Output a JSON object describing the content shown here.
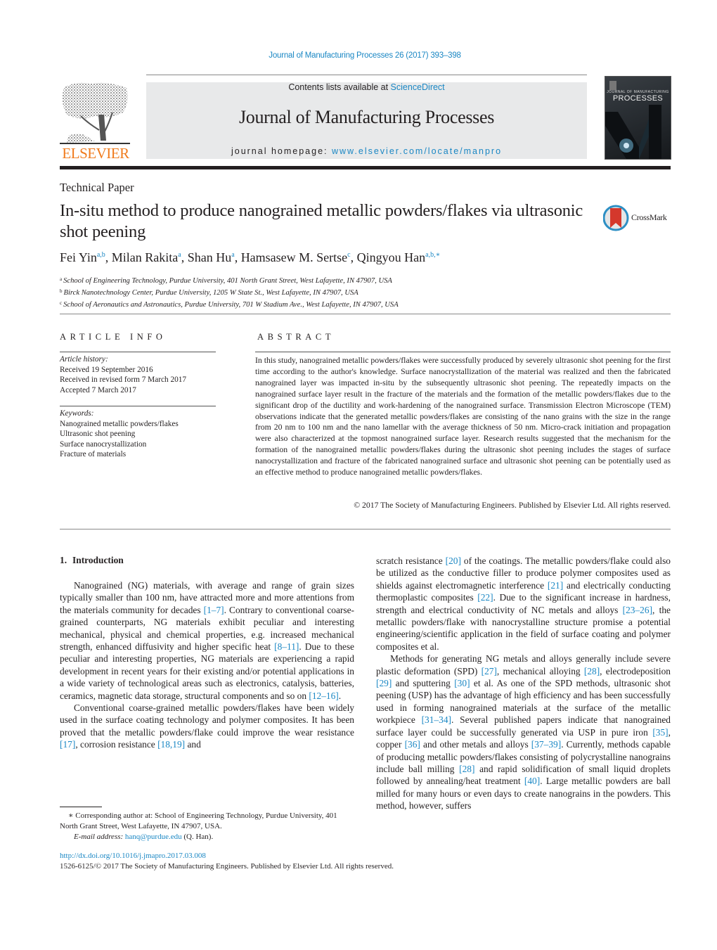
{
  "header": {
    "journal_ref": "Journal of Manufacturing Processes 26 (2017) 393–398",
    "contents_prefix": "Contents lists available at ",
    "contents_link": "ScienceDirect",
    "journal_title": "Journal of Manufacturing Processes",
    "homepage_prefix": "journal homepage: ",
    "homepage_link": "www.elsevier.com/locate/manpro",
    "publisher_logo_text": "ELSEVIER",
    "cover_title_small": "JOURNAL OF MANUFACTURING",
    "cover_title_large": "PROCESSES"
  },
  "article": {
    "section_type": "Technical Paper",
    "title": "In-situ method to produce nanograined metallic powders/flakes via ultrasonic shot peening",
    "crossmark_label": "CrossMark",
    "authors": [
      {
        "name": "Fei Yin",
        "sup": "a,b",
        "sep": ", "
      },
      {
        "name": "Milan Rakita",
        "sup": "a",
        "sep": ", "
      },
      {
        "name": "Shan Hu",
        "sup": "a",
        "sep": ", "
      },
      {
        "name": "Hamsasew M. Sertse",
        "sup": "c",
        "sep": ", "
      },
      {
        "name": "Qingyou Han",
        "sup": "a,b,∗",
        "sep": ""
      }
    ],
    "affiliations": [
      {
        "key": "a",
        "text": "School of Engineering Technology, Purdue University, 401 North Grant Street, West Lafayette, IN 47907, USA"
      },
      {
        "key": "b",
        "text": "Birck Nanotechnology Center, Purdue University, 1205 W State St., West Lafayette, IN 47907, USA"
      },
      {
        "key": "c",
        "text": "School of Aeronautics and Astronautics, Purdue University, 701 W Stadium Ave., West Lafayette, IN 47907, USA"
      }
    ]
  },
  "article_info": {
    "heading": "ARTICLE INFO",
    "history_label": "Article history:",
    "history": [
      "Received 19 September 2016",
      "Received in revised form 7 March 2017",
      "Accepted 7 March 2017"
    ],
    "keywords_label": "Keywords:",
    "keywords": [
      "Nanograined metallic powders/flakes",
      "Ultrasonic shot peening",
      "Surface nanocrystallization",
      "Fracture of materials"
    ]
  },
  "abstract": {
    "heading": "ABSTRACT",
    "text": "In this study, nanograined metallic powders/flakes were successfully produced by severely ultrasonic shot peening for the first time according to the author's knowledge. Surface nanocrystallization of the material was realized and then the fabricated nanograined layer was impacted in-situ by the subsequently ultrasonic shot peening. The repeatedly impacts on the nanograined surface layer result in the fracture of the materials and the formation of the metallic powders/flakes due to the significant drop of the ductility and work-hardening of the nanograined surface. Transmission Electron Microscope (TEM) observations indicate that the generated metallic powders/flakes are consisting of the nano grains with the size in the range from 20 nm to 100 nm and the nano lamellar with the average thickness of 50 nm. Micro-crack initiation and propagation were also characterized at the topmost nanograined surface layer. Research results suggested that the mechanism for the formation of the nanograined metallic powders/flakes during the ultrasonic shot peening includes the stages of surface nanocrystallization and fracture of the fabricated nanograined surface and ultrasonic shot peening can be potentially used as an effective method to produce nanograined metallic powders/flakes.",
    "copyright": "© 2017 The Society of Manufacturing Engineers. Published by Elsevier Ltd. All rights reserved."
  },
  "body": {
    "section_number": "1.",
    "section_title": "Introduction",
    "left_paragraphs": [
      [
        {
          "t": "Nanograined (NG) materials, with average and range of grain sizes typically smaller than 100 nm, have attracted more and more attentions from the materials community for decades "
        },
        {
          "ref": "[1–7]"
        },
        {
          "t": ". Contrary to conventional coarse-grained counterparts, NG materials exhibit peculiar and interesting mechanical, physical and chemical properties, e.g. increased mechanical strength, enhanced diffusivity and higher specific heat "
        },
        {
          "ref": "[8–11]"
        },
        {
          "t": ". Due to these peculiar and interesting properties, NG materials are experiencing a rapid development in recent years for their existing and/or potential applications in a wide variety of technological areas such as electronics, catalysis, batteries, ceramics, magnetic data storage, structural components and so on "
        },
        {
          "ref": "[12–16]"
        },
        {
          "t": "."
        }
      ],
      [
        {
          "t": "Conventional coarse-grained metallic powders/flakes have been widely used in the surface coating technology and polymer composites. It has been proved that the metallic powders/flake could improve the wear resistance "
        },
        {
          "ref": "[17]"
        },
        {
          "t": ", corrosion resistance "
        },
        {
          "ref": "[18,19]"
        },
        {
          "t": " and"
        }
      ]
    ],
    "right_paragraphs": [
      [
        {
          "t": "scratch resistance "
        },
        {
          "ref": "[20]"
        },
        {
          "t": " of the coatings. The metallic powders/flake could also be utilized as the conductive filler to produce polymer composites used as shields against electromagnetic interference "
        },
        {
          "ref": "[21]"
        },
        {
          "t": " and electrically conducting thermoplastic composites "
        },
        {
          "ref": "[22]"
        },
        {
          "t": ". Due to the significant increase in hardness, strength and electrical conductivity of NC metals and alloys "
        },
        {
          "ref": "[23–26]"
        },
        {
          "t": ", the metallic powders/flake with nanocrystalline structure promise a potential engineering/scientific application in the field of surface coating and polymer composites et al."
        }
      ],
      [
        {
          "t": "Methods for generating NG metals and alloys generally include severe plastic deformation (SPD) "
        },
        {
          "ref": "[27]"
        },
        {
          "t": ", mechanical alloying "
        },
        {
          "ref": "[28]"
        },
        {
          "t": ", electrodeposition "
        },
        {
          "ref": "[29]"
        },
        {
          "t": " and sputtering "
        },
        {
          "ref": "[30]"
        },
        {
          "t": " et al. As one of the SPD methods, ultrasonic shot peening (USP) has the advantage of high efficiency and has been successfully used in forming nanograined materials at the surface of the metallic workpiece "
        },
        {
          "ref": "[31–34]"
        },
        {
          "t": ". Several published papers indicate that nanograined surface layer could be successfully generated via USP in pure iron "
        },
        {
          "ref": "[35]"
        },
        {
          "t": ", copper "
        },
        {
          "ref": "[36]"
        },
        {
          "t": " and other metals and alloys "
        },
        {
          "ref": "[37–39]"
        },
        {
          "t": ". Currently, methods capable of producing metallic powders/flakes consisting of polycrystalline nanograins include ball milling "
        },
        {
          "ref": "[28]"
        },
        {
          "t": " and rapid solidification of small liquid droplets followed by annealing/heat treatment "
        },
        {
          "ref": "[40]"
        },
        {
          "t": ". Large metallic powders are ball milled for many hours or even days to create nanograins in the powders. This method, however, suffers"
        }
      ]
    ]
  },
  "footnotes": {
    "corresponding": "∗ Corresponding author at: School of Engineering Technology, Purdue University, 401 North Grant Street, West Lafayette, IN 47907, USA.",
    "email_label": "E-mail address: ",
    "email": "hanq@purdue.edu",
    "email_suffix": " (Q. Han).",
    "doi": "http://dx.doi.org/10.1016/j.jmapro.2017.03.008",
    "issn_line": "1526-6125/© 2017 The Society of Manufacturing Engineers. Published by Elsevier Ltd. All rights reserved."
  },
  "colors": {
    "link": "#1a87c4",
    "elsevier_orange": "#f07b1d",
    "banner_gray": "#e8e9ea",
    "text": "#231f20"
  }
}
